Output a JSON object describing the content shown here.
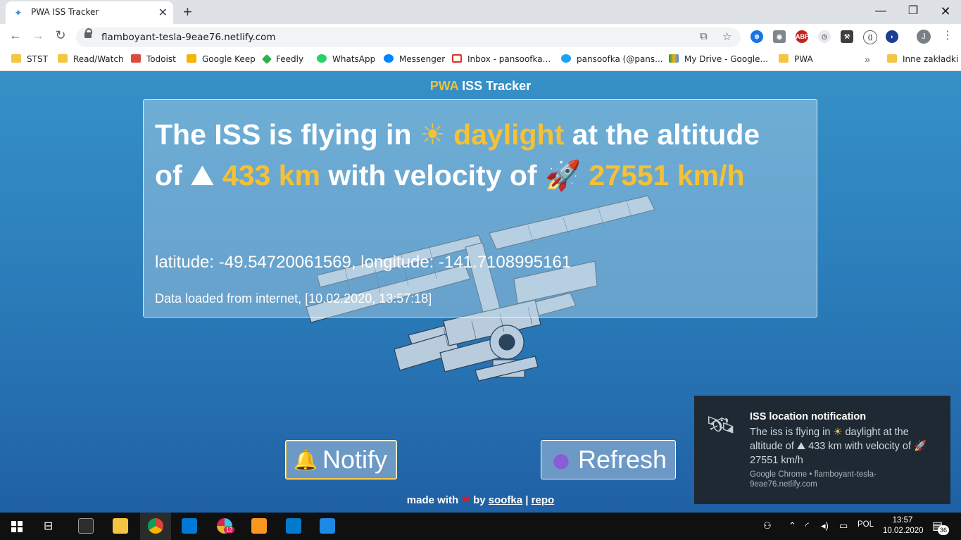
{
  "browser": {
    "tab_title": "PWA ISS Tracker",
    "url": "flamboyant-tesla-9eae76.netlify.com",
    "profile_initial": "J",
    "bookmarks": [
      "STST",
      "Read/Watch",
      "Todoist",
      "Google Keep",
      "Feedly",
      "WhatsApp",
      "Messenger",
      "Inbox - pansoofka...",
      "pansoofka (@pans...",
      "My Drive - Google...",
      "PWA"
    ],
    "other_bookmarks": "Inne zakładki"
  },
  "app": {
    "title_pwa": "PWA",
    "title_rest": " ISS Tracker",
    "headline": {
      "t1": "The ISS is flying in ",
      "e1": "☀",
      "h1": "daylight",
      "t2": " at the altitude of ",
      "e2": "⛰",
      "h2": "433 km",
      "t3": " with velocity of ",
      "e3": "🚀",
      "h3": "27551 km/h"
    },
    "coordinates": "latitude: -49.54720061569, longitude: -141.7108995161",
    "loaded": "Data loaded from internet, [10.02.2020, 13:57:18]",
    "notify_label": "Notify",
    "refresh_label": "Refresh",
    "footer": {
      "made_with": "made with",
      "heart": "❤",
      "by": "by",
      "author": "soofka",
      "separator": "|",
      "repo": "repo"
    }
  },
  "notification": {
    "title": "ISS location notification",
    "body_1": "The iss is flying in ",
    "emoji_1": "☀",
    "body_2": " daylight at the altitude of ",
    "emoji_2": "⛰",
    "body_3": " 433 km with velocity of ",
    "emoji_3": "🚀",
    "body_4": " 27551 km/h",
    "source": "Google Chrome • flamboyant-tesla-9eae76.netlify.com"
  },
  "taskbar": {
    "language": "POL",
    "time": "13:57",
    "date": "10.02.2020",
    "notification_count": "36",
    "slack_badge": "12"
  },
  "colors": {
    "accent_yellow": "#f5c135",
    "page_blue": "#2a7cb9"
  }
}
